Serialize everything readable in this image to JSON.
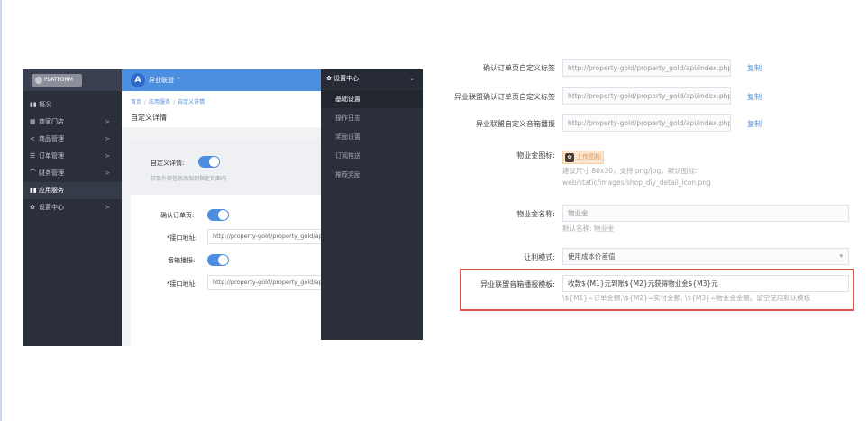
{
  "left": {
    "logo": "PLATFORM",
    "user": "异业联盟",
    "avatar_letter": "A",
    "top_caret": "^",
    "nav": [
      {
        "icon": "▮▮",
        "label": "概况",
        "chev": ""
      },
      {
        "icon": "▦",
        "label": "商家门店",
        "chev": ">"
      },
      {
        "icon": "<",
        "label": "商品管理",
        "chev": ">"
      },
      {
        "icon": "☰",
        "label": "订单管理",
        "chev": ">"
      },
      {
        "icon": "⌒",
        "label": "财务管理",
        "chev": ">"
      },
      {
        "icon": "▮▮",
        "label": "应用服务",
        "chev": ""
      },
      {
        "icon": "✿",
        "label": "设置中心",
        "chev": ">"
      }
    ],
    "breadcrumb": [
      "首页",
      "/",
      "应用服务",
      "/",
      "自定义详情"
    ],
    "page_title": "自定义详情",
    "custom_detail_label": "自定义详情:",
    "custom_detail_hint": "获取外部信息添加到指定页面内",
    "confirm_order_label": "确认订单页:",
    "api_label_1": "*接口地址:",
    "api_url_1": "http://property-gold/property_gold/api/index.php",
    "speaker_label": "音箱播报:",
    "api_label_2": "*接口地址:",
    "api_url_2": "http://property-gold/property_gold/api/index.php",
    "dropdown": {
      "title": "设置中心",
      "items": [
        "基础设置",
        "操作日志",
        "奖励设置",
        "订阅推送",
        "推荐奖励"
      ]
    }
  },
  "right": {
    "row0_label": "确认订单页自定义标签",
    "row0_value": "http://property-gold/property_gold/api/index.php",
    "row1_label": "异业联盟确认订单页自定义标签",
    "row1_value": "http://property-gold/property_gold/api/index.php",
    "row2_label": "异业联盟自定义音箱播报",
    "row2_value": "http://property-gold/property_gold/api/index.php",
    "copy": "复制",
    "icon_label": "物业金图标:",
    "icon_chip": "上传图标",
    "icon_hint_1": "建议尺寸 80x30，支持 png/jpg，默认图标:",
    "icon_hint_2": "web/static/images/shop_diy_detail_icon.png",
    "name_label": "物业金名称:",
    "name_value": "物业金",
    "name_hint": "默认名称: 物业金",
    "mode_label": "让利模式:",
    "mode_value": "使用成本价差值",
    "tpl_label": "异业联盟音箱播报模板:",
    "tpl_value": "收款${M1}元到账${M2}元获得物业金${M3}元",
    "tpl_hint": "\\${M1}=订单金额,\\${M2}=实付金额, \\${M3}=物业金金额。留空使用默认模板"
  },
  "colors": {
    "accent": "#4c8fe0",
    "sidebar": "#2b2f3a",
    "highlight": "#d9534f"
  }
}
